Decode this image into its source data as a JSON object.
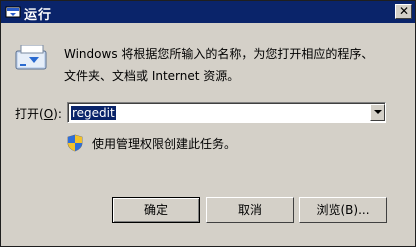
{
  "window": {
    "title": "运行",
    "close_glyph": "✕"
  },
  "description": {
    "line1": "Windows 将根据您所输入的名称，为您打开相应的程序、",
    "line2": "文件夹、文档或 Internet 资源。"
  },
  "open_field": {
    "label_prefix": "打开(",
    "label_accel": "O",
    "label_suffix": "):",
    "value": "regedit"
  },
  "admin_note": "使用管理权限创建此任务。",
  "buttons": {
    "ok": "确定",
    "cancel": "取消",
    "browse": "浏览(B)..."
  },
  "colors": {
    "titlebar": "#0a246a",
    "dialog_bg": "#d4d0c8",
    "selection": "#0a246a"
  }
}
